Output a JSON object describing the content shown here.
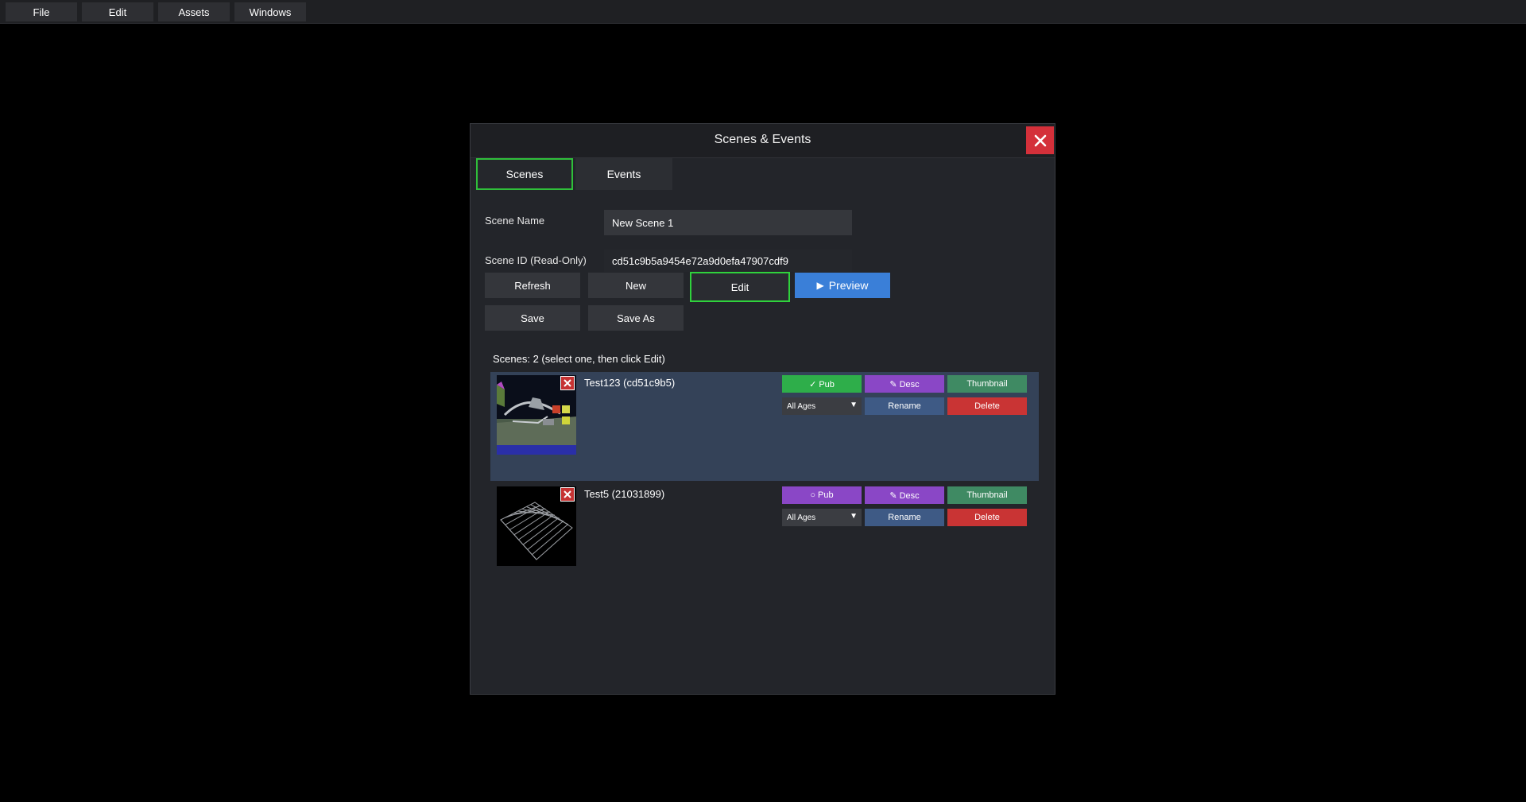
{
  "menubar": {
    "items": [
      "File",
      "Edit",
      "Assets",
      "Windows"
    ]
  },
  "dialog": {
    "title": "Scenes & Events",
    "tabs": [
      {
        "label": "Scenes",
        "active": true
      },
      {
        "label": "Events",
        "active": false
      }
    ],
    "scene_name_label": "Scene Name",
    "scene_name_value": "New Scene 1",
    "scene_id_label": "Scene ID (Read-Only)",
    "scene_id_value": "cd51c9b5a9454e72a9d0efa47907cdf9",
    "buttons": {
      "refresh": "Refresh",
      "new": "New",
      "edit": "Edit",
      "preview": "Preview",
      "save": "Save",
      "save_as": "Save As"
    },
    "scene_count_text": "Scenes: 2 (select one, then click Edit)",
    "scenes": [
      {
        "name": "Test123 (cd51c9b5)",
        "selected": true,
        "pub_label": "✓ Pub",
        "pub_state": "published",
        "desc_label": "✎ Desc",
        "thumbnail_label": "Thumbnail",
        "age_label": "All Ages",
        "rename_label": "Rename",
        "delete_label": "Delete"
      },
      {
        "name": "Test5 (21031899)",
        "selected": false,
        "pub_label": "○ Pub",
        "pub_state": "unpublished",
        "desc_label": "✎ Desc",
        "thumbnail_label": "Thumbnail",
        "age_label": "All Ages",
        "rename_label": "Rename",
        "delete_label": "Delete"
      }
    ]
  },
  "colors": {
    "accent_green": "#2fd23c",
    "preview_blue": "#3a7fd8",
    "close_red": "#d4303a",
    "selected_row": "#344258"
  }
}
